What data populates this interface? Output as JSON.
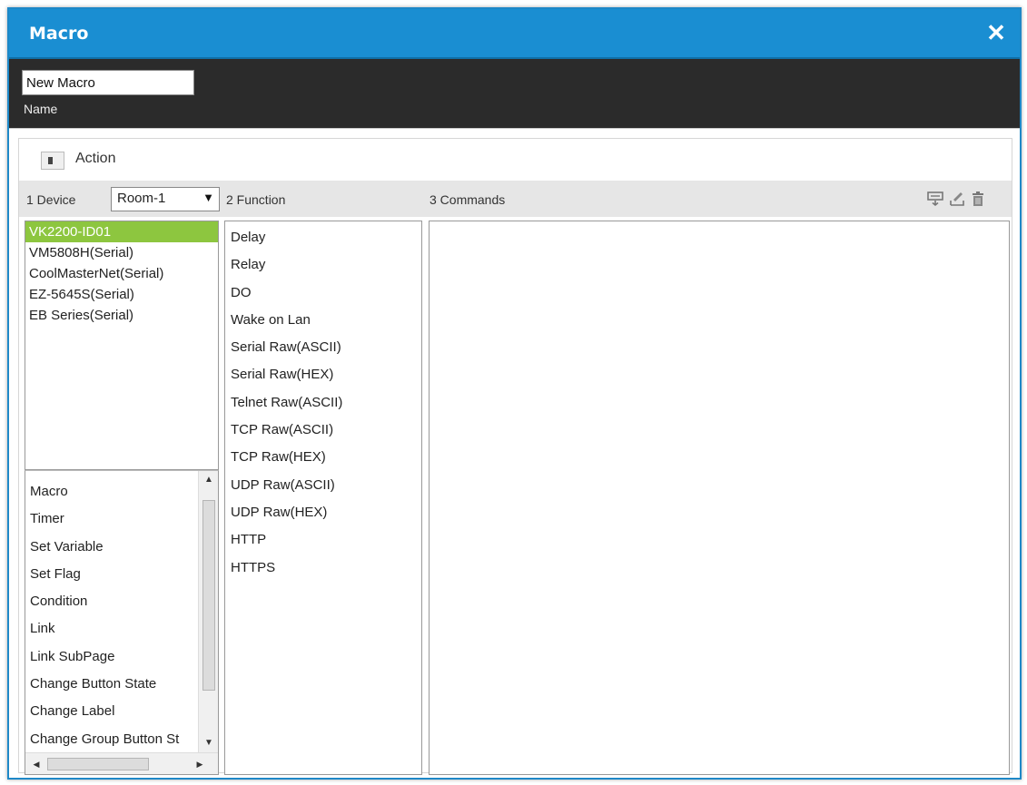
{
  "window": {
    "title": "Macro",
    "close_icon": "close-icon"
  },
  "name": {
    "value": "New Macro",
    "label": "Name"
  },
  "action": {
    "label": "Action"
  },
  "headers": {
    "device": "1  Device",
    "function": "2  Function",
    "commands": "3  Commands"
  },
  "room_select": {
    "value": "Room-1"
  },
  "devices": [
    "VK2200-ID01",
    "VM5808H(Serial)",
    "CoolMasterNet(Serial)",
    "EZ-5645S(Serial)",
    "EB Series(Serial)"
  ],
  "functions": [
    "Delay",
    "Relay",
    "DO",
    "Wake on Lan",
    "Serial Raw(ASCII)",
    "Serial Raw(HEX)",
    "Telnet Raw(ASCII)",
    "TCP Raw(ASCII)",
    "TCP Raw(HEX)",
    "UDP Raw(ASCII)",
    "UDP Raw(HEX)",
    "HTTP",
    "HTTPS"
  ],
  "actions": [
    "Macro",
    "Timer",
    "Set Variable",
    "Set Flag",
    "Condition",
    "Link",
    "Link SubPage",
    "Change Button State",
    "Change Label",
    "Change Group Button St"
  ],
  "colors": {
    "title_bar": "#1a8ed2",
    "selected_item": "#8dc63f",
    "dark_band": "#2b2b2b"
  }
}
